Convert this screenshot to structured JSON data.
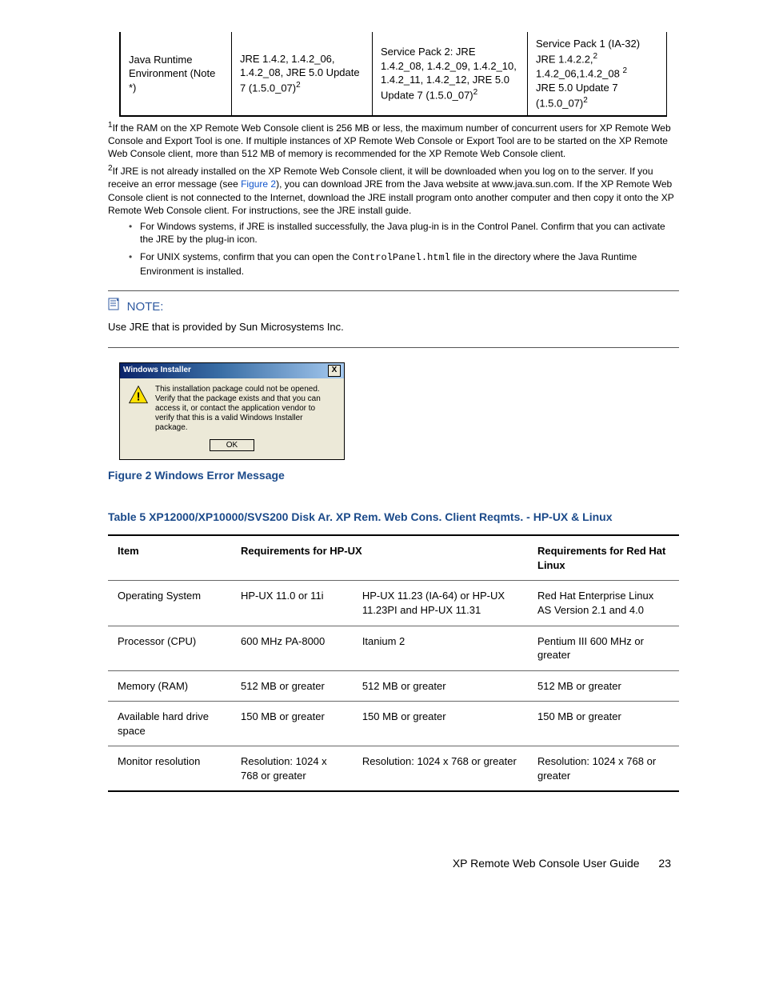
{
  "jre_row": {
    "c1": "Java Runtime Environment (Note *)",
    "c2_a": "JRE 1.4.2, 1.4.2_06, 1.4.2_08, JRE 5.0 Update 7 (1.5.0_07)",
    "c3_a": "Service Pack 2: JRE 1.4.2_08, 1.4.2_09, 1.4.2_10, 1.4.2_11, 1.4.2_12, JRE 5.0 Update 7 (1.5.0_07)",
    "c4_l1": "Service Pack 1 (IA-32) JRE 1.4.2.2,",
    "c4_l2": "1.4.2_06,1.4.2_08 ",
    "c4_l3": "JRE 5.0 Update 7 (1.5.0_07)",
    "sup": "2"
  },
  "footnote1": "If the RAM on the XP Remote Web Console client is 256 MB or less, the maximum number of concurrent users for XP Remote Web Console and Export Tool is one. If multiple instances of XP Remote Web Console or Export Tool are to be started on the XP Remote Web Console client, more than 512 MB of memory is recommended for the XP Remote Web Console client.",
  "footnote2a": "If JRE is not already installed on the XP Remote Web Console client, it will be downloaded when you log on to the server. If you receive an error message (see ",
  "footnote2_link": "Figure 2",
  "footnote2b": "), you can download JRE from the Java website at www.java.sun.com. If the XP Remote Web Console client is not connected to the Internet, download the JRE install program onto another computer and then copy it onto the XP Remote Web Console client. For instructions, see the JRE install guide.",
  "bullet1": "For Windows systems, if JRE is installed successfully, the Java plug-in is in the Control Panel. Confirm that you can activate the JRE by the plug-in icon.",
  "bullet2a": "For UNIX systems, confirm that you can open the ",
  "bullet2_code": "ControlPanel.html",
  "bullet2b": " file in the directory where the Java Runtime Environment is installed.",
  "note_label": "NOTE:",
  "note_text": "Use JRE that is provided by Sun Microsystems Inc.",
  "dialog": {
    "title": "Windows Installer",
    "body": "This installation package could not be opened.  Verify that the package exists and that you can access it, or contact the application vendor to verify that this is a valid Windows Installer package.",
    "ok": "OK",
    "close": "X"
  },
  "figure_caption": "Figure 2 Windows Error Message",
  "table_title": "Table 5 XP12000/XP10000/SVS200 Disk Ar. XP Rem. Web Cons. Client Reqmts. - HP-UX & Linux",
  "table": {
    "h1": "Item",
    "h2": "Requirements for HP-UX",
    "h3": "Requirements for Red Hat Linux",
    "r1": {
      "c1": "Operating System",
      "c2": "HP-UX 11.0 or 11i",
      "c3": "HP-UX 11.23 (IA-64) or HP-UX 11.23PI and HP-UX 11.31",
      "c4": "Red Hat Enterprise Linux AS Version 2.1 and 4.0"
    },
    "r2": {
      "c1": "Processor (CPU)",
      "c2": "600 MHz PA-8000",
      "c3": "Itanium 2",
      "c4": "Pentium III 600 MHz or greater"
    },
    "r3": {
      "c1": "Memory (RAM)",
      "c2": "512 MB or greater",
      "c3": "512 MB or greater",
      "c4": "512 MB or greater"
    },
    "r4": {
      "c1": "Available hard drive space",
      "c2": "150 MB or greater",
      "c3": "150 MB or greater",
      "c4": "150 MB or greater"
    },
    "r5": {
      "c1": "Monitor resolution",
      "c2": "Resolution: 1024 x 768 or greater",
      "c3": "Resolution: 1024 x 768 or greater",
      "c4": "Resolution: 1024 x 768 or greater"
    }
  },
  "footer": {
    "title": "XP Remote Web Console User Guide",
    "page": "23"
  }
}
